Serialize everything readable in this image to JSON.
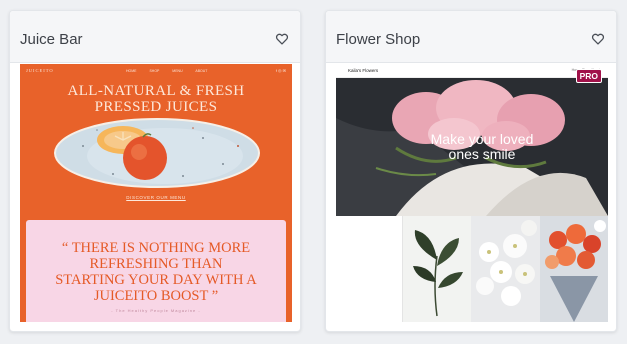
{
  "cards": [
    {
      "title": "Juice Bar",
      "favorite_icon": "heart-outline-icon",
      "preview": {
        "logo": "JUICEITO",
        "nav_links": "HOME SHOP MENU ABOUT",
        "headline_line1": "ALL-NATURAL & FRESH",
        "headline_line2": "PRESSED JUICES",
        "cta": "DISCOVER OUR MENU",
        "quote_line1": "“ THERE IS NOTHING MORE",
        "quote_line2": "REFRESHING THAN",
        "quote_line3": "STARTING YOUR DAY WITH A",
        "quote_line4": "JUICEITO BOOST ”",
        "quote_attribution": "- The Healthy People Magazine -",
        "colors": {
          "accent": "#e8622a",
          "quote_bg": "#f8d6e6"
        }
      }
    },
    {
      "title": "Flower Shop",
      "favorite_icon": "heart-outline-icon",
      "badge": "PRO",
      "preview": {
        "brand": "Kaila's Flowers",
        "nav_links": "Home Shop About",
        "hero_line1": "Make your loved",
        "hero_line2": "ones smile",
        "colors": {
          "badge": "#a1124a"
        }
      }
    }
  ]
}
